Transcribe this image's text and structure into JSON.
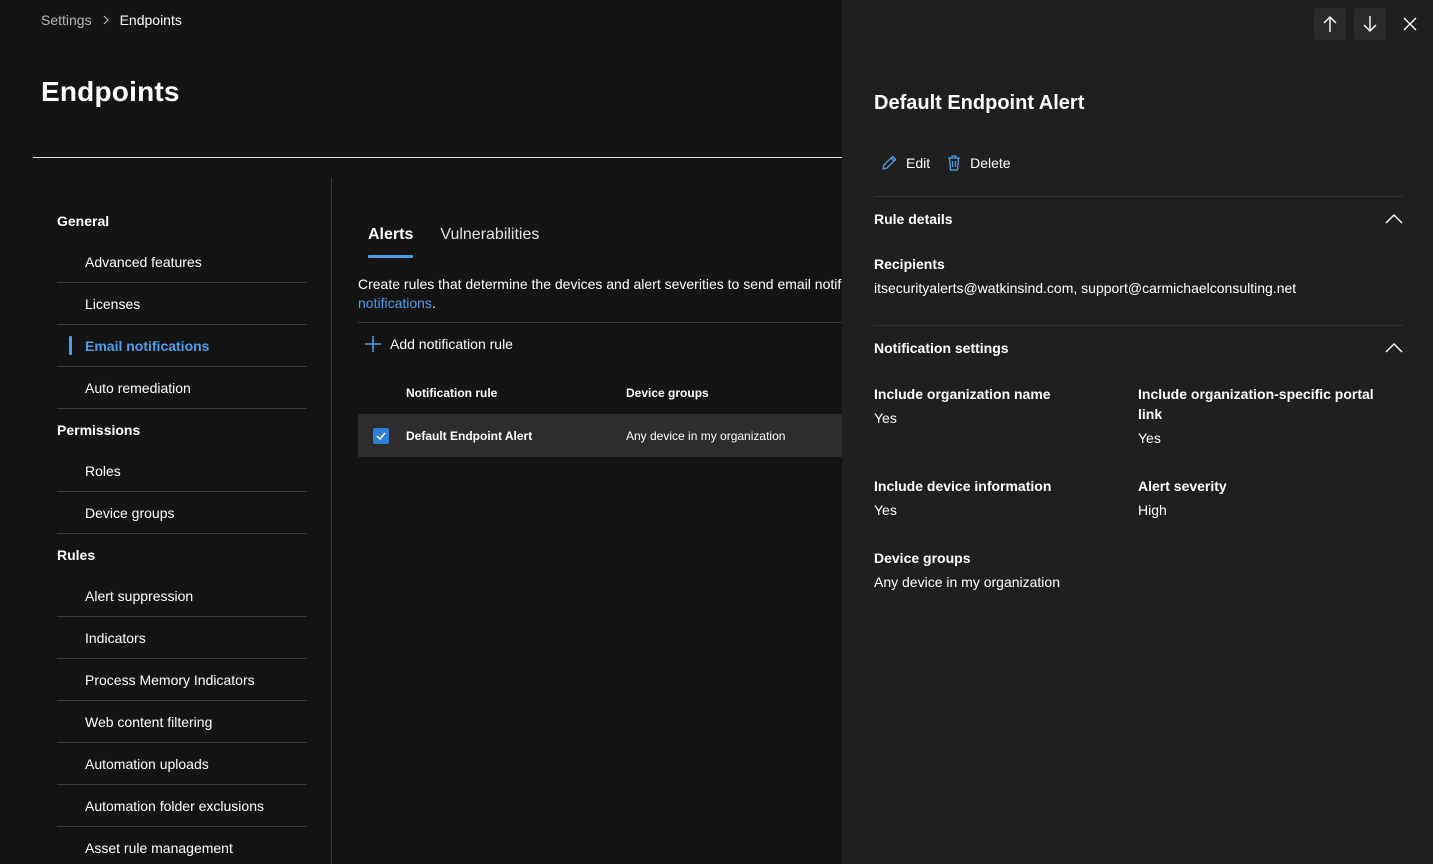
{
  "breadcrumb": {
    "parent": "Settings",
    "current": "Endpoints"
  },
  "page": {
    "title": "Endpoints"
  },
  "sidebar": {
    "sections": [
      {
        "title": "General",
        "items": [
          "Advanced features",
          "Licenses",
          "Email notifications",
          "Auto remediation"
        ]
      },
      {
        "title": "Permissions",
        "items": [
          "Roles",
          "Device groups"
        ]
      },
      {
        "title": "Rules",
        "items": [
          "Alert suppression",
          "Indicators",
          "Process Memory Indicators",
          "Web content filtering",
          "Automation uploads",
          "Automation folder exclusions",
          "Asset rule management"
        ]
      }
    ],
    "active_item": "Email notifications"
  },
  "tabs": [
    {
      "label": "Alerts",
      "active": true
    },
    {
      "label": "Vulnerabilities",
      "active": false
    }
  ],
  "description": {
    "text": "Create rules that determine the devices and alert severities to send email notifi",
    "link": "notifications",
    "suffix": "."
  },
  "toolbar": {
    "add_rule_label": "Add notification rule"
  },
  "table": {
    "columns": [
      "Notification rule",
      "Device groups"
    ],
    "rows": [
      {
        "rule": "Default Endpoint Alert",
        "groups": "Any device in my organization",
        "selected": true
      }
    ]
  },
  "panel": {
    "title": "Default Endpoint Alert",
    "actions": {
      "edit": "Edit",
      "delete": "Delete"
    },
    "rule_details": {
      "title": "Rule details",
      "recipients_label": "Recipients",
      "recipients_value": "itsecurityalerts@watkinsind.com, support@carmichaelconsulting.net"
    },
    "notification_settings": {
      "title": "Notification settings",
      "org_name_label": "Include organization name",
      "org_name_value": "Yes",
      "portal_link_label_1": "Include organization-specific portal",
      "portal_link_label_2": "link",
      "portal_link_value": "Yes",
      "device_info_label": "Include device information",
      "device_info_value": "Yes",
      "severity_label": "Alert severity",
      "severity_value": "High",
      "device_groups_label": "Device groups",
      "device_groups_value": "Any device in my organization"
    }
  },
  "colors": {
    "accent": "#4f9de9",
    "background": "#141414",
    "panel": "#1f1f1f",
    "row_selected": "#2d2d2d"
  }
}
